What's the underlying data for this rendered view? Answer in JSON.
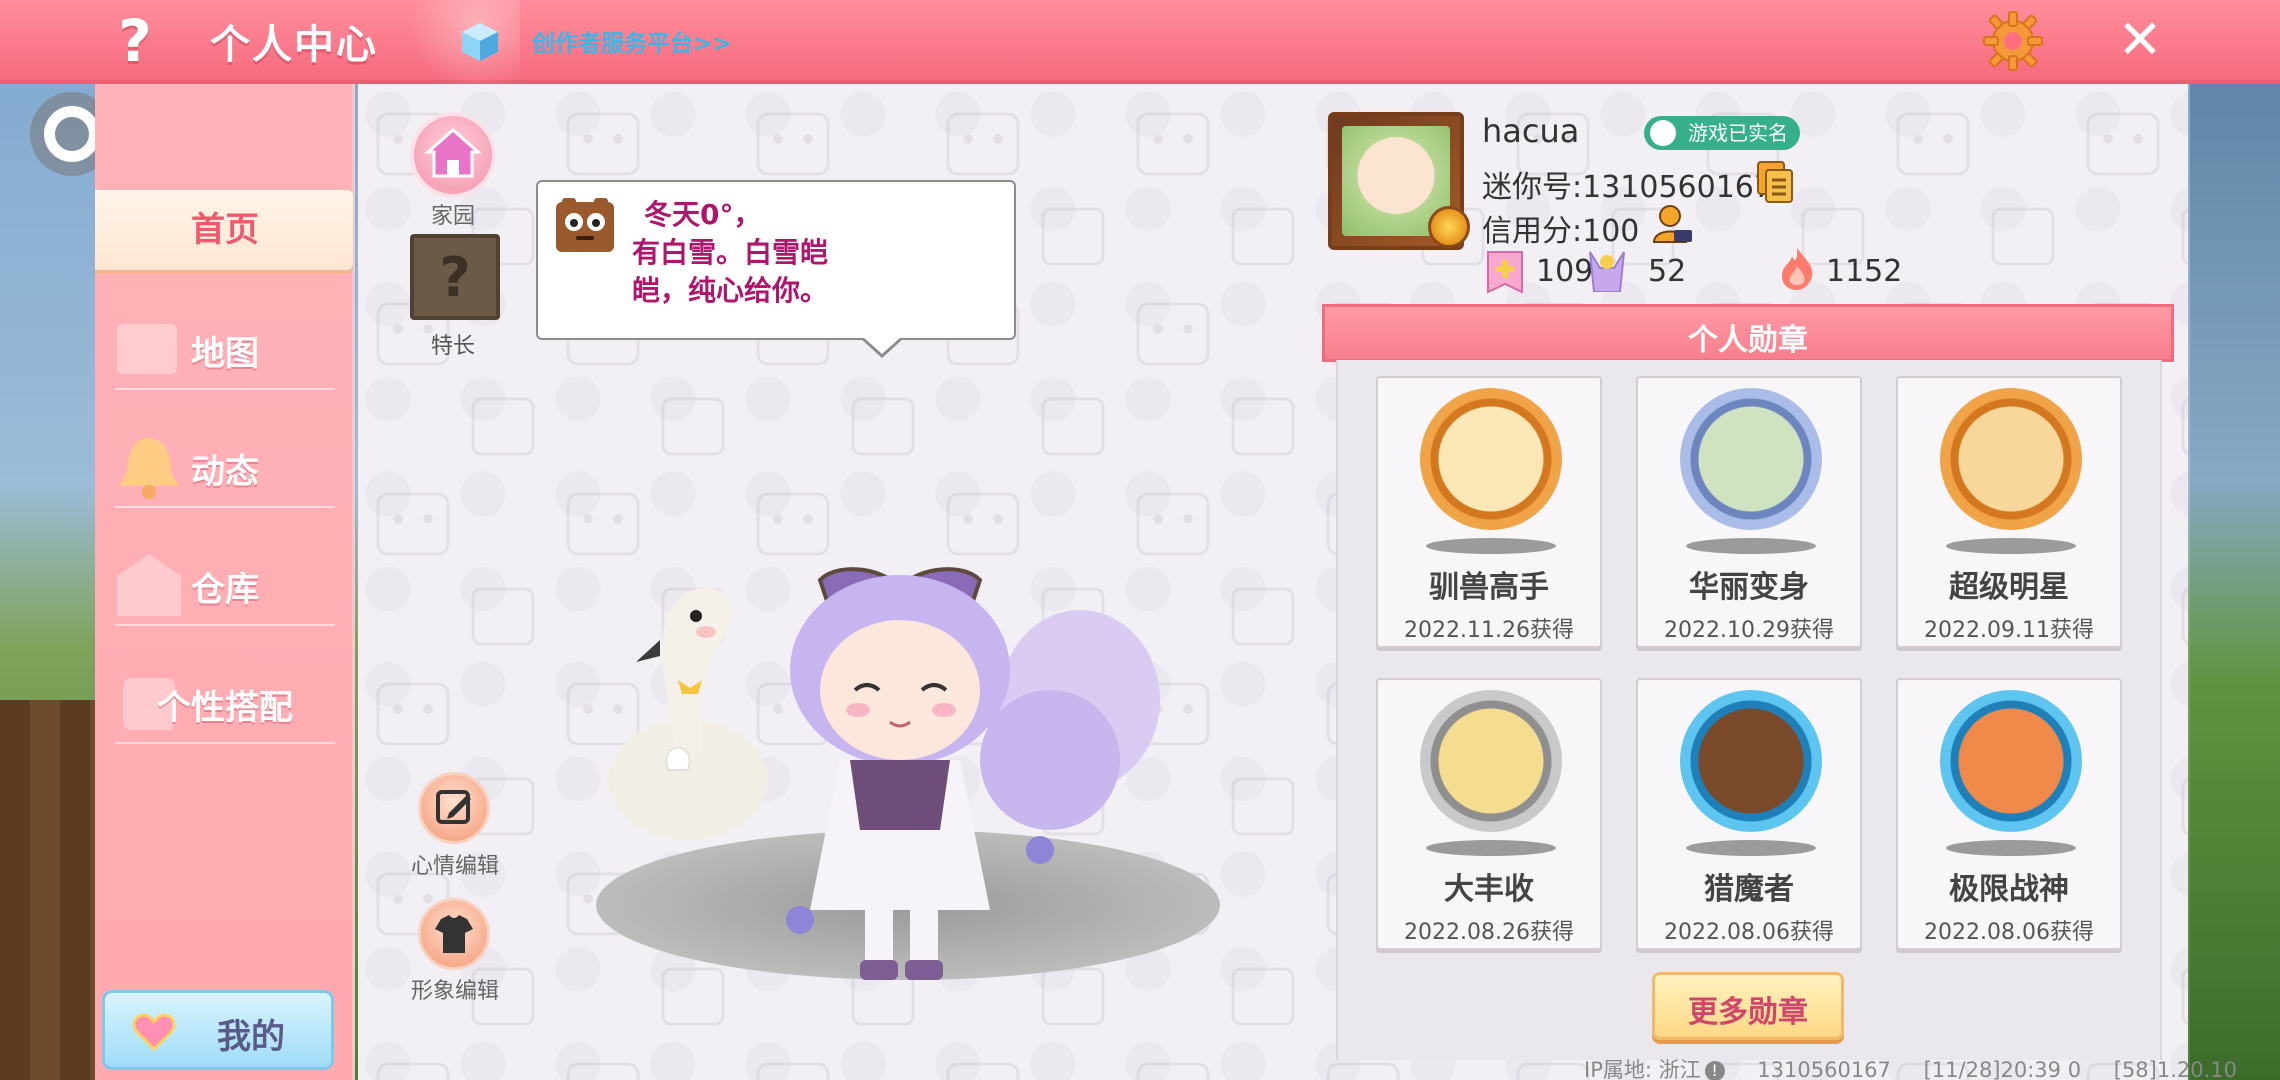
{
  "header": {
    "help_label": "?",
    "title": "个人中心",
    "creator_link": "创作者服务平台>>",
    "close_label": "✕"
  },
  "sidebar": {
    "items": [
      {
        "label": "首页"
      },
      {
        "label": "地图"
      },
      {
        "label": "动态"
      },
      {
        "label": "仓库"
      },
      {
        "label": "个性搭配"
      }
    ],
    "mine_label": "我的"
  },
  "main": {
    "home_label": "家园",
    "talent_label": "特长",
    "talent_glyph": "?",
    "mood_text_line1": "冬天0°，",
    "mood_text_line2": "有白雪。白雪皑",
    "mood_text_line3": "皑，纯心给你。",
    "mood_edit_label": "心情编辑",
    "look_edit_label": "形象编辑"
  },
  "profile": {
    "username": "hacua",
    "realname_badge": "游戏已实名",
    "mini_id": "迷你号:1310560167",
    "credit": "信用分:100",
    "stats": [
      {
        "icon": "plus-flag-icon",
        "value": "109"
      },
      {
        "icon": "cheer-icon",
        "value": "52"
      },
      {
        "icon": "flame-icon",
        "value": "1152"
      }
    ]
  },
  "medals": {
    "header": "个人勋章",
    "items": [
      {
        "name": "驯兽高手",
        "date": "2022.11.26获得",
        "icon": "monkey-horse-medal-icon",
        "color": "#e9a24a"
      },
      {
        "name": "华丽变身",
        "date": "2022.10.29获得",
        "icon": "dino-medal-icon",
        "color": "#8fa7d6"
      },
      {
        "name": "超级明星",
        "date": "2022.09.11获得",
        "icon": "bear-star-medal-icon",
        "color": "#e9a24a"
      },
      {
        "name": "大丰收",
        "date": "2022.08.26获得",
        "icon": "harvest-medal-icon",
        "color": "#a9a9a9"
      },
      {
        "name": "猎魔者",
        "date": "2022.08.06获得",
        "icon": "swords-medal-icon",
        "color": "#3fa6d9"
      },
      {
        "name": "极限战神",
        "date": "2022.08.06获得",
        "icon": "boss-medal-icon",
        "color": "#3fa6d9"
      }
    ],
    "more_label": "更多勋章"
  },
  "footer": {
    "ip_location": "IP属地: 浙江",
    "uid": "1310560167",
    "time": "[11/28]20:39 0",
    "version": "[58]1.20.10"
  },
  "colors": {
    "accent": "#f66b7e",
    "sidebar": "#ffb3b8",
    "link": "#3ab7e6",
    "mood_text": "#b0156e"
  }
}
